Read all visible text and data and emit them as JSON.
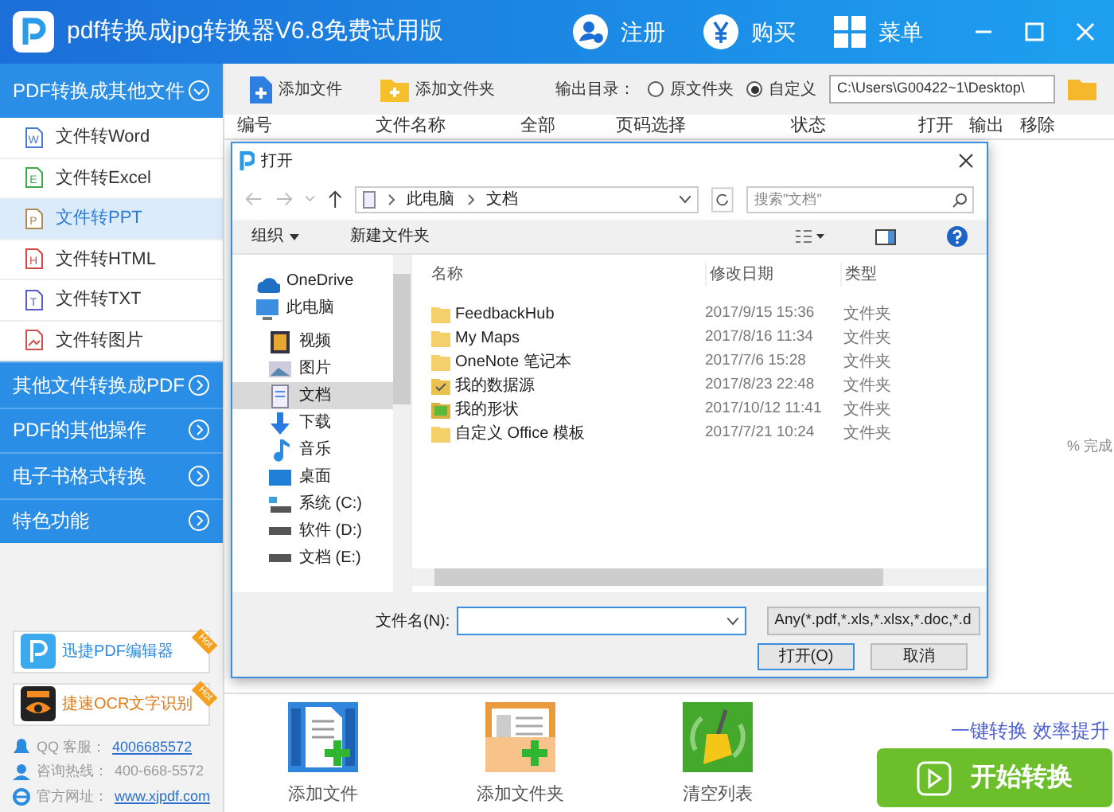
{
  "window": {
    "title": "pdf转换成jpg转换器V6.8免费试用版",
    "actions": [
      {
        "label": "注册",
        "kind": "user"
      },
      {
        "label": "购买",
        "kind": "yen"
      },
      {
        "label": "菜单",
        "kind": "grid"
      }
    ]
  },
  "sidebar": {
    "header": {
      "label": "PDF转换成其他文件",
      "expanded": true
    },
    "items": [
      {
        "label": "文件转Word",
        "letter": "W",
        "color": "#4a7bd0",
        "selected": false
      },
      {
        "label": "文件转Excel",
        "letter": "E",
        "color": "#3ea84a",
        "selected": false
      },
      {
        "label": "文件转PPT",
        "letter": "P",
        "color": "#b08a50",
        "selected": true
      },
      {
        "label": "文件转HTML",
        "letter": "H",
        "color": "#d04848",
        "selected": false
      },
      {
        "label": "文件转TXT",
        "letter": "T",
        "color": "#5a5ac8",
        "selected": false
      },
      {
        "label": "文件转图片",
        "color": "#d05050",
        "selected": false
      }
    ],
    "sections": [
      {
        "label": "其他文件转换成PDF"
      },
      {
        "label": "PDF的其他操作"
      },
      {
        "label": "电子书格式转换"
      },
      {
        "label": "特色功能"
      }
    ],
    "promos": [
      {
        "label": "迅捷PDF编辑器",
        "kind": "pdf",
        "badge": "Hot"
      },
      {
        "label": "捷速OCR文字识别",
        "kind": "ocr",
        "badge": "Hot"
      }
    ],
    "contacts": [
      {
        "label": "QQ 客服：",
        "value": "4006685572",
        "kind": "qq",
        "link": true
      },
      {
        "label": "咨询热线：",
        "value": "400-668-5572",
        "kind": "phone",
        "link": false
      },
      {
        "label": "官方网址：",
        "value": "www.xjpdf.com",
        "kind": "web",
        "link": true
      }
    ]
  },
  "toolbar": {
    "buttons": [
      {
        "label": "添加文件",
        "kind": "file"
      },
      {
        "label": "添加文件夹",
        "kind": "folder"
      }
    ],
    "output_label": "输出目录：",
    "options": [
      {
        "label": "原文件夹",
        "selected": false
      },
      {
        "label": "自定义",
        "selected": true
      }
    ],
    "path": "C:\\Users\\G00422~1\\Desktop\\"
  },
  "table": {
    "columns": [
      "编号",
      "文件名称",
      "全部",
      "页码选择",
      "状态",
      "打开",
      "输出",
      "移除"
    ]
  },
  "progress_text": "% 完成",
  "dialog": {
    "title": "打开",
    "breadcrumb": [
      "此电脑",
      "文档"
    ],
    "search": {
      "placeholder": "搜索\"文档\""
    },
    "organize": "组织",
    "new_folder": "新建文件夹",
    "nav": [
      {
        "label": "OneDrive",
        "kind": "cloud",
        "selected": false
      },
      {
        "label": "此电脑",
        "kind": "pc",
        "selected": false,
        "children": [
          {
            "label": "视频",
            "kind": "video",
            "selected": false
          },
          {
            "label": "图片",
            "kind": "image",
            "selected": false
          },
          {
            "label": "文档",
            "kind": "doc",
            "selected": true
          },
          {
            "label": "下载",
            "kind": "download",
            "selected": false
          },
          {
            "label": "音乐",
            "kind": "music",
            "selected": false
          },
          {
            "label": "桌面",
            "kind": "desktop",
            "selected": false
          },
          {
            "label": "系统 (C:)",
            "kind": "sysdrive",
            "selected": false
          },
          {
            "label": "软件 (D:)",
            "kind": "drive",
            "selected": false
          },
          {
            "label": "文档 (E:)",
            "kind": "drive",
            "selected": false
          }
        ]
      }
    ],
    "columns": [
      "名称",
      "修改日期",
      "类型"
    ],
    "files": [
      {
        "name": "FeedbackHub",
        "date": "2017/9/15 15:36",
        "type": "文件夹",
        "kind": "folder"
      },
      {
        "name": "My Maps",
        "date": "2017/8/16 11:34",
        "type": "文件夹",
        "kind": "folder"
      },
      {
        "name": "OneNote 笔记本",
        "date": "2017/7/6 15:28",
        "type": "文件夹",
        "kind": "folder"
      },
      {
        "name": "我的数据源",
        "date": "2017/8/23 22:48",
        "type": "文件夹",
        "kind": "datasource"
      },
      {
        "name": "我的形状",
        "date": "2017/10/12 11:41",
        "type": "文件夹",
        "kind": "shapes"
      },
      {
        "name": "自定义 Office 模板",
        "date": "2017/7/21 10:24",
        "type": "文件夹",
        "kind": "folder"
      }
    ],
    "filename_label": "文件名(N):",
    "filter": "Any(*.pdf,*.xls,*.xlsx,*.doc,*.d",
    "open_button": "打开(O)",
    "cancel_button": "取消"
  },
  "bottom": {
    "actions": [
      {
        "label": "添加文件",
        "kind": "file"
      },
      {
        "label": "添加文件夹",
        "kind": "folder"
      },
      {
        "label": "清空列表",
        "kind": "clear"
      }
    ],
    "slogan": "一键转换 效率提升",
    "start_button": "开始转换"
  }
}
